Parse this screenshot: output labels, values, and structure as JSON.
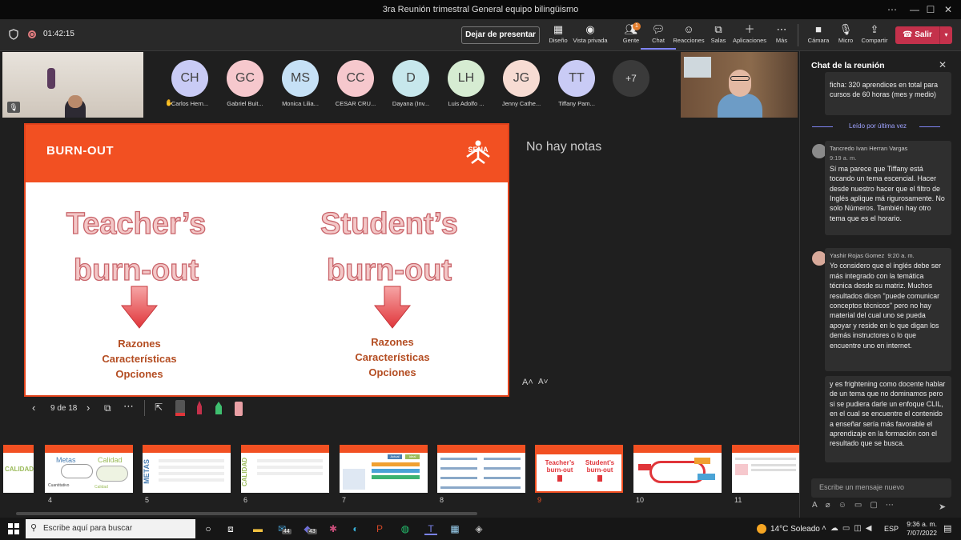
{
  "window": {
    "title": "3ra Reunión trimestral General equipo bilingüismo"
  },
  "toolbar": {
    "timer": "01:42:15",
    "present_label": "Dejar de presentar",
    "layout_label": "Diseño",
    "private_label": "Vista privada",
    "people_label": "Gente",
    "people_badge": "1",
    "chat_label": "Chat",
    "reactions_label": "Reacciones",
    "rooms_label": "Salas",
    "apps_label": "Aplicaciones",
    "more_label": "Más",
    "camera_label": "Cámara",
    "mic_label": "Micro",
    "share_label": "Compartir",
    "leave_label": "Salir"
  },
  "participants": [
    {
      "initials": "CH",
      "name": "Carlos Hern...",
      "color": "#c9cbf5"
    },
    {
      "initials": "GC",
      "name": "Gabriel Buit...",
      "color": "#f6c8cd"
    },
    {
      "initials": "MS",
      "name": "Monica Lilia...",
      "color": "#c6e1f6"
    },
    {
      "initials": "CC",
      "name": "CESAR CRU...",
      "color": "#f6c8cd"
    },
    {
      "initials": "D",
      "name": "Dayana (Inv...",
      "color": "#c7e7ec"
    },
    {
      "initials": "LH",
      "name": "Luis Adolfo ...",
      "color": "#d6ecd2"
    },
    {
      "initials": "JG",
      "name": "Jenny Cathe...",
      "color": "#f7dcd3"
    },
    {
      "initials": "TT",
      "name": "Tiffany Pam...",
      "color": "#c9cbf5"
    }
  ],
  "overflow_count": "+7",
  "slide": {
    "header": "BURN-OUT",
    "logo": "SENA",
    "left_title_1": "Teacher’s",
    "left_title_2": "burn-out",
    "right_title_1": "Student’s",
    "right_title_2": "burn-out",
    "items_left": [
      "Razones",
      "Características",
      "Opciones"
    ],
    "items_right": [
      "Razones",
      "Características",
      "Opciones"
    ]
  },
  "notes_text": "No hay notas",
  "slide_nav": {
    "position": "9 de 18"
  },
  "thumbnails": [
    "4",
    "5",
    "6",
    "7",
    "8",
    "9",
    "10",
    "11"
  ],
  "thumb_titles": {
    "t4a": "Metas",
    "t4b": "Calidad",
    "t4c": "Cuantitativo",
    "t4d": "Calidad",
    "t5": "METAS",
    "t6": "CALIDAD",
    "t7a": "Actual",
    "t7b": "Ideal",
    "t9a": "Teacher’s",
    "t9b": "burn-out",
    "t9c": "Student’s",
    "t9d": "burn-out",
    "t_calidad": "CALIDAD"
  },
  "chat": {
    "title": "Chat de la reunión",
    "prev_text": "ficha: 320 aprendices en total para cursos de 60 horas (mes y medio)",
    "read_divider": "Leído por última vez",
    "messages": [
      {
        "author": "Tancredo Ivan Herran Vargas",
        "time": "9:19 a. m.",
        "text": "Sí ma parece que Tiffany está tocando un tema escencial. Hacer desde nuestro hacer que el filtro de Inglés aplique má rigurosamente. No solo Números. También hay otro tema que es el horario."
      },
      {
        "author": "Yashir Rojas Gomez",
        "time": "9:20 a. m.",
        "text": "Yo considero que el inglés debe ser más integrado con la temática técnica desde su matriz. Muchos resultados dicen \"puede comunicar conceptos técnicos\" pero no hay material del cual uno se pueda apoyar y reside en lo que digan los demás instructores o lo que encuentre uno en internet."
      }
    ],
    "followup": "y es frightening como docente hablar de un tema que no dominamos pero si se pudiera darle un enfoque CLIL, en el cual se encuentre el contenido a enseñar sería más favorable el aprendizaje en la formación con el resultado que se busca.",
    "compose_placeholder": "Escribe un mensaje nuevo"
  },
  "taskbar": {
    "search_placeholder": "Escribe aquí para buscar",
    "badge_a": "44",
    "badge_b": "43",
    "weather": "14°C  Soleado",
    "lang": "ESP",
    "time": "9:36 a. m.",
    "date": "7/07/2022"
  }
}
